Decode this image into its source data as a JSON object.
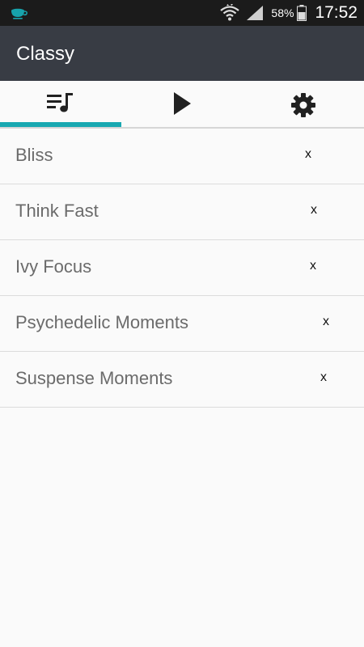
{
  "status_bar": {
    "app_icon": "teacup-icon",
    "battery_percent": "58%",
    "time": "17:52",
    "colors": {
      "background": "#1b1b1b",
      "app_icon": "#17a3ac"
    }
  },
  "app_bar": {
    "title": "Classy",
    "background": "#383c44"
  },
  "tabs": [
    {
      "icon": "playlist-icon",
      "selected": true
    },
    {
      "icon": "play-icon",
      "selected": false
    },
    {
      "icon": "gear-icon",
      "selected": false
    }
  ],
  "accent_color": "#18a8b1",
  "playlists": [
    {
      "name": "Bliss",
      "remove_label": "x"
    },
    {
      "name": "Think Fast",
      "remove_label": "x"
    },
    {
      "name": "Ivy Focus",
      "remove_label": "x"
    },
    {
      "name": "Psychedelic Moments",
      "remove_label": "x"
    },
    {
      "name": "Suspense Moments",
      "remove_label": "x"
    }
  ]
}
